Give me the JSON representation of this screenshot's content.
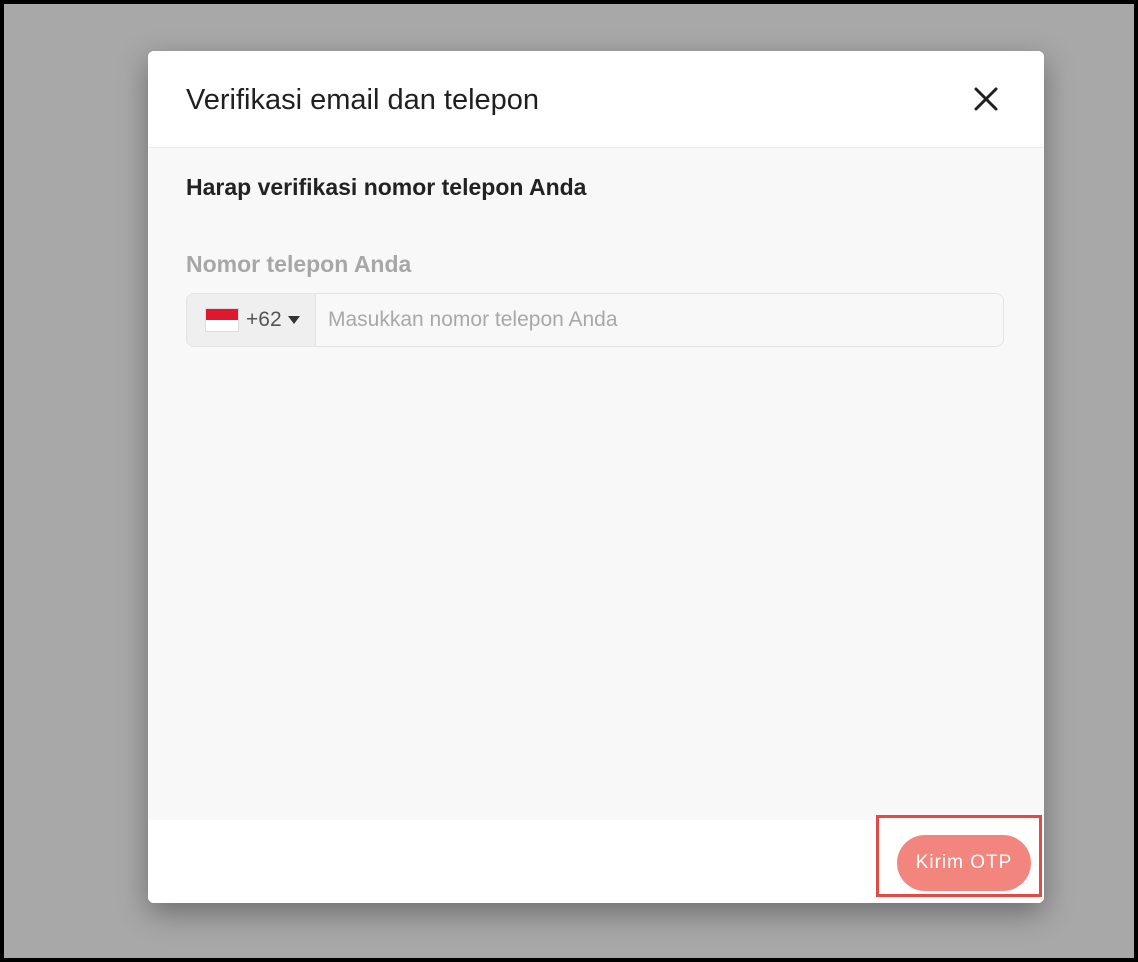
{
  "modal": {
    "title": "Verifikasi email dan telepon",
    "close_icon": "close-icon"
  },
  "body": {
    "heading": "Harap verifikasi nomor telepon Anda",
    "phone_label": "Nomor telepon Anda",
    "country": {
      "flag_icon": "indonesia-flag-icon",
      "dial_code": "+62",
      "chevron_icon": "chevron-down-icon"
    },
    "phone_input": {
      "value": "",
      "placeholder": "Masukkan nomor telepon Anda"
    }
  },
  "footer": {
    "send_otp_label": "Kirim OTP"
  },
  "colors": {
    "overlay": "#a8a8a8",
    "modal_bg": "#ffffff",
    "body_bg": "#f8f8f8",
    "primary_button": "#f2867f",
    "highlight": "#e24b43",
    "flag_red": "#e0172d",
    "flag_white": "#ffffff"
  }
}
